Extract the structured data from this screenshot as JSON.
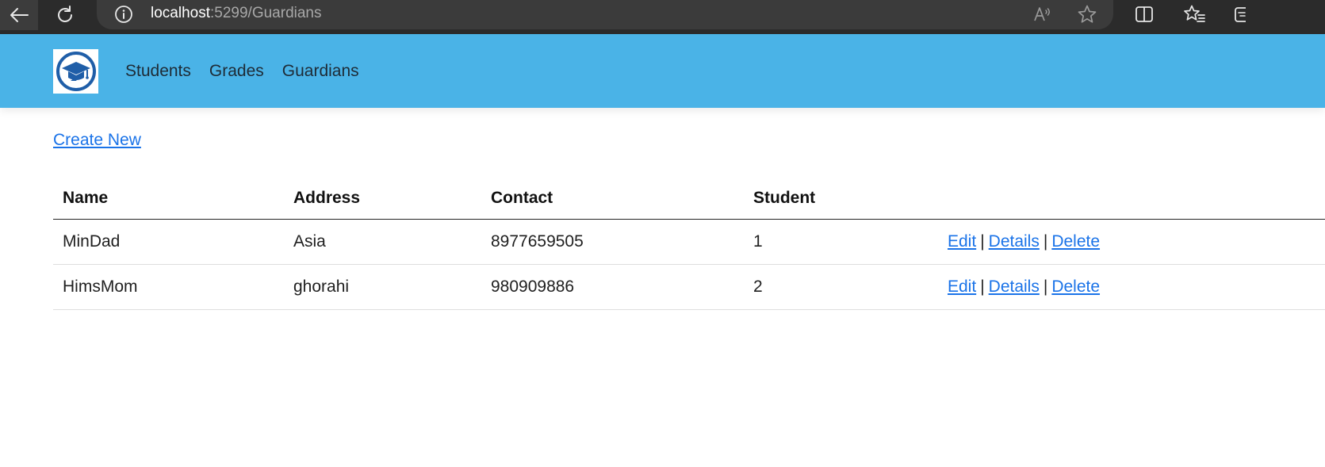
{
  "browser": {
    "url_host": "localhost",
    "url_path": ":5299/Guardians"
  },
  "navbar": {
    "links": [
      "Students",
      "Grades",
      "Guardians"
    ]
  },
  "main": {
    "create_new_label": "Create New",
    "columns": [
      "Name",
      "Address",
      "Contact",
      "Student"
    ],
    "rows": [
      {
        "name": "MinDad",
        "address": "Asia",
        "contact": "8977659505",
        "student": "1"
      },
      {
        "name": "HimsMom",
        "address": "ghorahi",
        "contact": "980909886",
        "student": "2"
      }
    ],
    "row_actions": {
      "edit": "Edit",
      "details": "Details",
      "delete": "Delete",
      "separator": "|"
    }
  },
  "icons": {
    "back": "arrow-left-icon",
    "refresh": "refresh-icon",
    "site_info": "info-icon",
    "read_aloud": "read-aloud-icon",
    "favorite": "star-icon",
    "split_screen": "split-screen-icon",
    "favorites_bar": "favorites-icon",
    "collections": "collections-icon",
    "logo": "graduation-cap-icon"
  },
  "colors": {
    "navbar_bg": "#4ab3e7",
    "link": "#1a73e8",
    "browser_bg": "#2b2b2b"
  }
}
